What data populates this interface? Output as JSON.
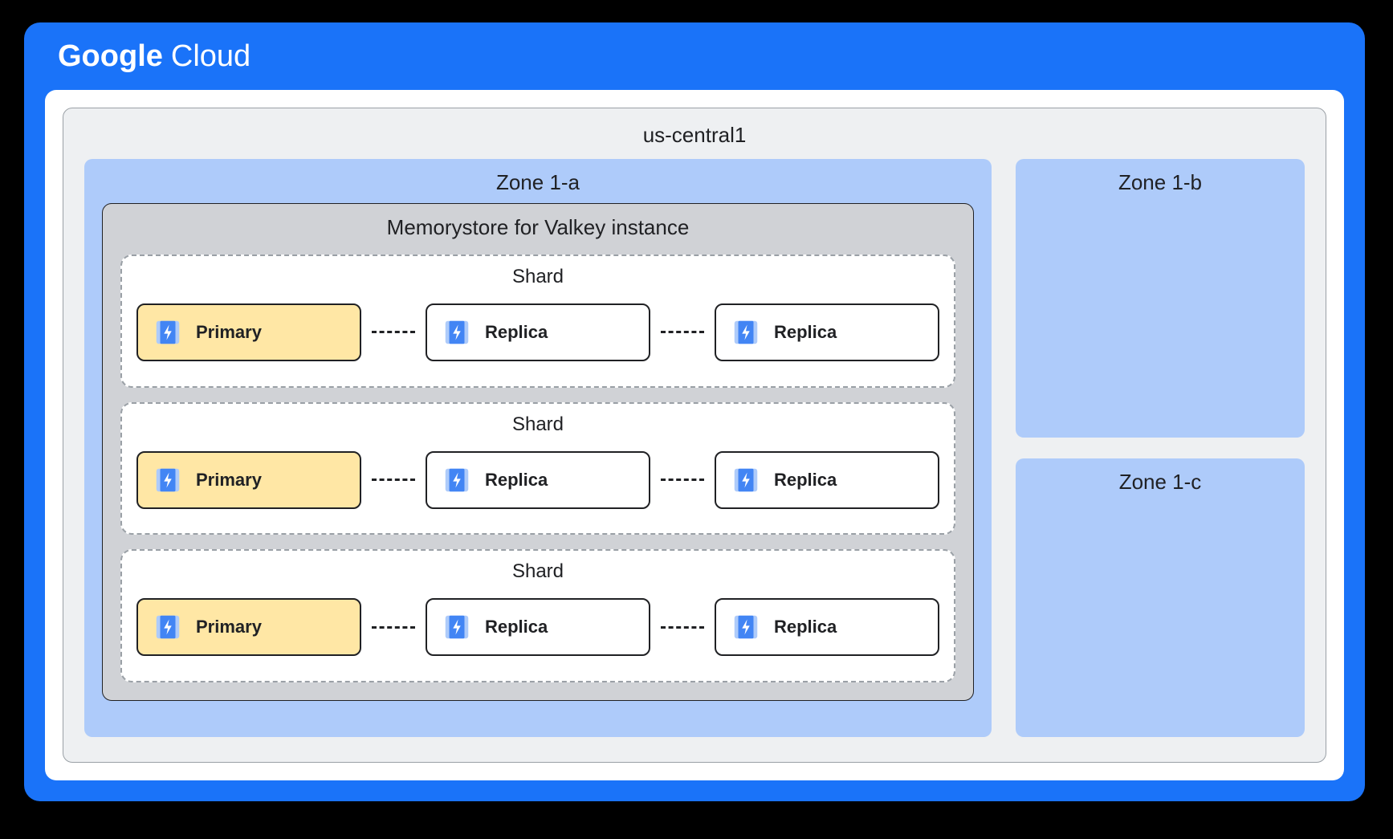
{
  "brand": {
    "part1": "Google",
    "part2": "Cloud"
  },
  "region": {
    "name": "us-central1"
  },
  "zones": {
    "a": {
      "label": "Zone 1-a"
    },
    "b": {
      "label": "Zone 1-b"
    },
    "c": {
      "label": "Zone 1-c"
    }
  },
  "instance": {
    "title": "Memorystore for Valkey instance",
    "shards": [
      {
        "label": "Shard",
        "nodes": [
          {
            "role": "Primary",
            "kind": "primary"
          },
          {
            "role": "Replica",
            "kind": "replica"
          },
          {
            "role": "Replica",
            "kind": "replica"
          }
        ]
      },
      {
        "label": "Shard",
        "nodes": [
          {
            "role": "Primary",
            "kind": "primary"
          },
          {
            "role": "Replica",
            "kind": "replica"
          },
          {
            "role": "Replica",
            "kind": "replica"
          }
        ]
      },
      {
        "label": "Shard",
        "nodes": [
          {
            "role": "Primary",
            "kind": "primary"
          },
          {
            "role": "Replica",
            "kind": "replica"
          },
          {
            "role": "Replica",
            "kind": "replica"
          }
        ]
      }
    ]
  },
  "colors": {
    "cloud_blue": "#1a73f9",
    "zone_fill": "#aecbfa",
    "instance_fill": "#d0d2d6",
    "primary_fill": "#ffe7a5",
    "replica_fill": "#ffffff",
    "icon_dark": "#4285f4",
    "icon_light": "#aecbfa"
  }
}
